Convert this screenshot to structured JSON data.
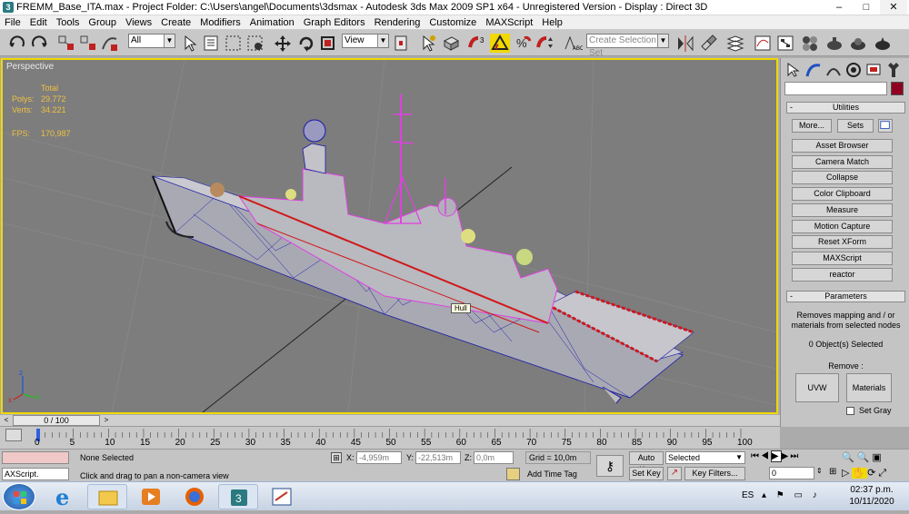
{
  "window": {
    "title": "FREMM_Base_ITA.max    - Project Folder: C:\\Users\\angel\\Documents\\3dsmax    - Autodesk 3ds Max  2009 SP1  x64   - Unregistered Version    - Display : Direct 3D",
    "app_icon": "3ds-max-logo",
    "minimize": "–",
    "maximize": "□",
    "close": "✕"
  },
  "menu": [
    "File",
    "Edit",
    "Tools",
    "Group",
    "Views",
    "Create",
    "Modifiers",
    "Animation",
    "Graph Editors",
    "Rendering",
    "Customize",
    "MAXScript",
    "Help"
  ],
  "toolbar": {
    "selection_filter": "All",
    "reference_coord": "View",
    "named_selection_placeholder": "Create Selection Set"
  },
  "viewport": {
    "label": "Perspective",
    "stats": {
      "header": "Total",
      "polys_label": "Polys:",
      "polys": "29.772",
      "verts_label": "Verts:",
      "verts": "34.221",
      "fps_label": "FPS:",
      "fps": "170,987"
    },
    "tooltip": "Hull",
    "axis_x": "x",
    "axis_y": "y",
    "axis_z": "z",
    "colors": {
      "background": "#7d7d7d",
      "border": "#f0d800",
      "grid": "#8c8c8c",
      "wire_blue": "#1a1aa8",
      "wire_pink": "#e040e0",
      "wire_red": "#d01818"
    }
  },
  "command_panel": {
    "tabs": [
      "create-icon",
      "modify-icon",
      "hierarchy-icon",
      "motion-icon",
      "display-icon",
      "utilities-icon"
    ],
    "utilities": {
      "header": "Utilities",
      "more": "More...",
      "sets": "Sets",
      "items": [
        "Asset Browser",
        "Camera Match",
        "Collapse",
        "Color Clipboard",
        "Measure",
        "Motion Capture",
        "Reset XForm",
        "MAXScript",
        "reactor"
      ]
    },
    "parameters": {
      "header": "Parameters",
      "description": "Removes mapping and / or materials from selected nodes",
      "selected": "0 Object(s) Selected",
      "remove_label": "Remove :",
      "uvw": "UVW",
      "materials": "Materials",
      "set_gray": "Set Gray"
    }
  },
  "timeslider": {
    "position": "0 / 100",
    "ticks": [
      "0",
      "5",
      "10",
      "15",
      "20",
      "25",
      "30",
      "35",
      "40",
      "45",
      "50",
      "55",
      "60",
      "65",
      "70",
      "75",
      "80",
      "85",
      "90",
      "95",
      "100"
    ]
  },
  "status": {
    "selection": "None Selected",
    "prompt": "Click and drag to pan a non-camera view",
    "maxscript": "AXScript.",
    "x_label": "X:",
    "x": "-4,959m",
    "y_label": "Y:",
    "y": "-22,513m",
    "z_label": "Z:",
    "z": "0,0m",
    "grid": "Grid = 10,0m",
    "add_time_tag": "Add Time Tag",
    "auto_key": "Auto Key",
    "set_key": "Set Key",
    "key_mode": "Selected",
    "key_filters": "Key Filters...",
    "frame": "0"
  },
  "taskbar": {
    "lang": "ES",
    "time": "02:37 p.m.",
    "date": "10/11/2020",
    "apps": [
      "explorer-icon",
      "ie-icon",
      "media-player-icon",
      "firefox-icon",
      "3dsmax-icon",
      "presentation-icon"
    ]
  }
}
